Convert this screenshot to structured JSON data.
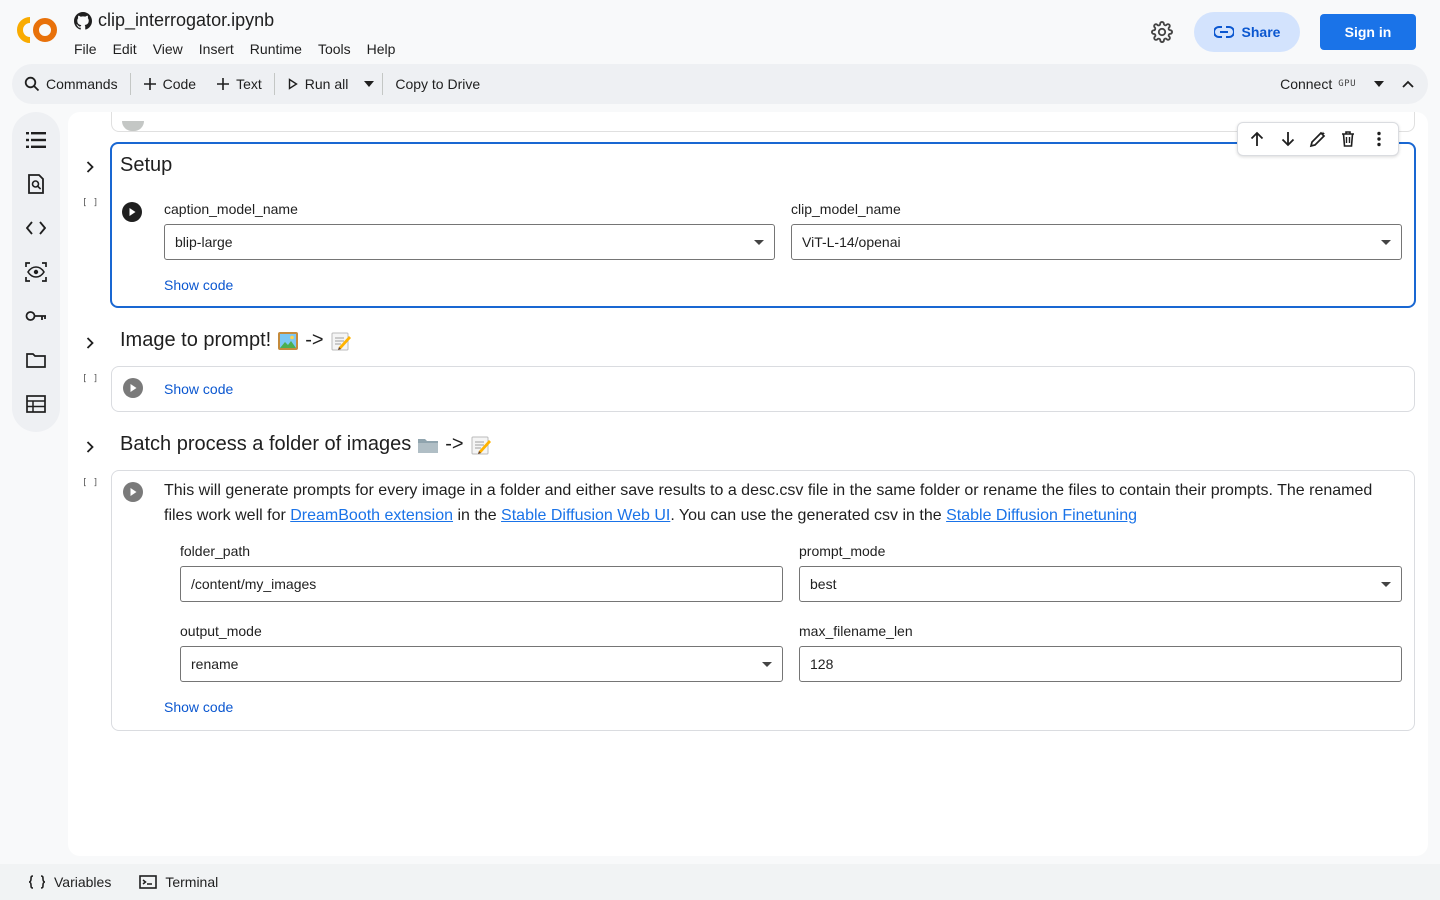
{
  "header": {
    "filename": "clip_interrogator.ipynb",
    "menu": [
      "File",
      "Edit",
      "View",
      "Insert",
      "Runtime",
      "Tools",
      "Help"
    ],
    "share_label": "Share",
    "signin_label": "Sign in",
    "logo_text": "CO"
  },
  "toolbar": {
    "commands": "Commands",
    "code": "Code",
    "text": "Text",
    "run_all": "Run all",
    "copy_to_drive": "Copy to Drive",
    "connect": "Connect",
    "gpu": "GPU"
  },
  "sidebar": {
    "icons": [
      "toc-icon",
      "find-replace-icon",
      "code-snippets-icon",
      "variables-inspector-icon",
      "secrets-key-icon",
      "files-folder-icon",
      "data-table-icon"
    ]
  },
  "sections": {
    "setup": {
      "title": "Setup",
      "exec_count": "[ ]",
      "caption_label": "caption_model_name",
      "caption_value": "blip-large",
      "clip_label": "clip_model_name",
      "clip_value": "ViT-L-14/openai",
      "show_code": "Show code"
    },
    "image_to_prompt": {
      "title": "Image to prompt!",
      "arrow": "->",
      "exec_count": "[ ]",
      "show_code": "Show code"
    },
    "batch": {
      "title": "Batch process a folder of images",
      "arrow": "->",
      "exec_count": "[ ]",
      "desc_1": "This will generate prompts for every image in a folder and either save results to a desc.csv file in the same folder or rename the files to contain their prompts. The renamed files work well for ",
      "link_dreambooth": "DreamBooth extension",
      "desc_2": " in the ",
      "link_webui": "Stable Diffusion Web UI",
      "desc_3": ". You can use the generated csv in the ",
      "link_finetune": "Stable Diffusion Finetuning",
      "folder_label": "folder_path",
      "folder_value": "/content/my_images",
      "prompt_mode_label": "prompt_mode",
      "prompt_mode_value": "best",
      "output_mode_label": "output_mode",
      "output_mode_value": "rename",
      "max_len_label": "max_filename_len",
      "max_len_value": "128",
      "show_code": "Show code"
    }
  },
  "bottombar": {
    "variables": "Variables",
    "terminal": "Terminal"
  },
  "colors": {
    "accent": "#1967d2",
    "link": "#1a73e8",
    "share_bg": "#d3e3fd",
    "signin_bg": "#1a73e8"
  }
}
